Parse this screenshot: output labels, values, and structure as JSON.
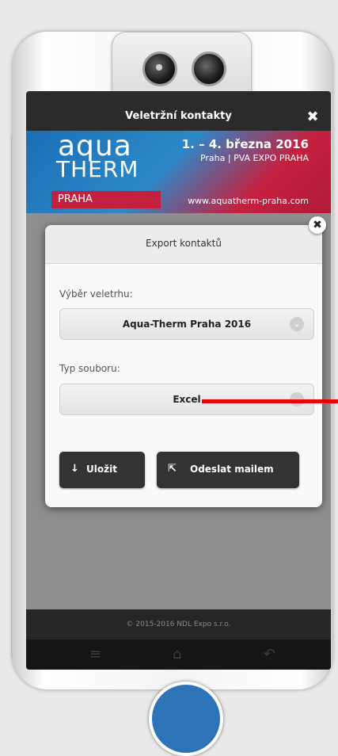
{
  "appbar": {
    "title": "Veletržní kontakty"
  },
  "banner": {
    "brand_line1": "aqua",
    "brand_line2": "THERM",
    "city": "PRAHA",
    "dates": "1. – 4. března 2016",
    "venue": "Praha | PVA EXPO PRAHA",
    "website": "www.aquatherm-praha.com"
  },
  "dialog": {
    "title": "Export kontaktů",
    "fair_label": "Výběr veletrhu:",
    "fair_value": "Aqua-Therm Praha 2016",
    "type_label": "Typ souboru:",
    "type_value": "Excel",
    "save_label": "Uložit",
    "mail_label": "Odeslat mailem"
  },
  "footer": {
    "copyright": "© 2015-2016 NDL Expo s.r.o."
  },
  "colors": {
    "annotation": "#e8000b",
    "accent": "#2d73b8",
    "button_dark": "#333333"
  }
}
